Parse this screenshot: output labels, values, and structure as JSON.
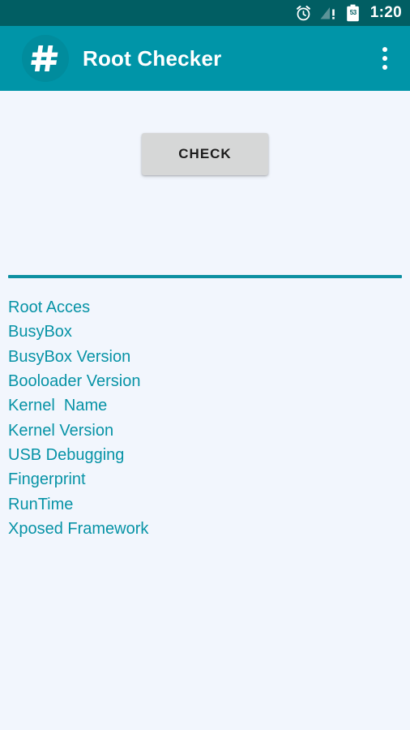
{
  "status_bar": {
    "icons": [
      {
        "name": "alarm-clock-icon",
        "label": "alarm"
      },
      {
        "name": "signal-warning-icon",
        "label": "no service"
      },
      {
        "name": "battery-icon",
        "label": "battery"
      }
    ],
    "battery_level": "53",
    "time": "1:20",
    "background_color": "#015E63"
  },
  "app_bar": {
    "title": "Root Checker",
    "logo_icon": "hash-icon",
    "overflow_icon": "more-vertical-icon",
    "background_color": "#0095A8",
    "title_color": "#FFFFFF"
  },
  "main": {
    "check_button_label": "CHECK",
    "divider_color": "#0D90A2",
    "background_color": "#F2F6FD",
    "label_color": "#0793A6",
    "items": [
      {
        "label": "Root Acces"
      },
      {
        "label": "BusyBox"
      },
      {
        "label": "BusyBox Version"
      },
      {
        "label": "Booloader Version"
      },
      {
        "label": "Kernel  Name"
      },
      {
        "label": "Kernel Version"
      },
      {
        "label": "USB Debugging"
      },
      {
        "label": "Fingerprint"
      },
      {
        "label": "RunTime"
      },
      {
        "label": "Xposed Framework"
      }
    ]
  }
}
